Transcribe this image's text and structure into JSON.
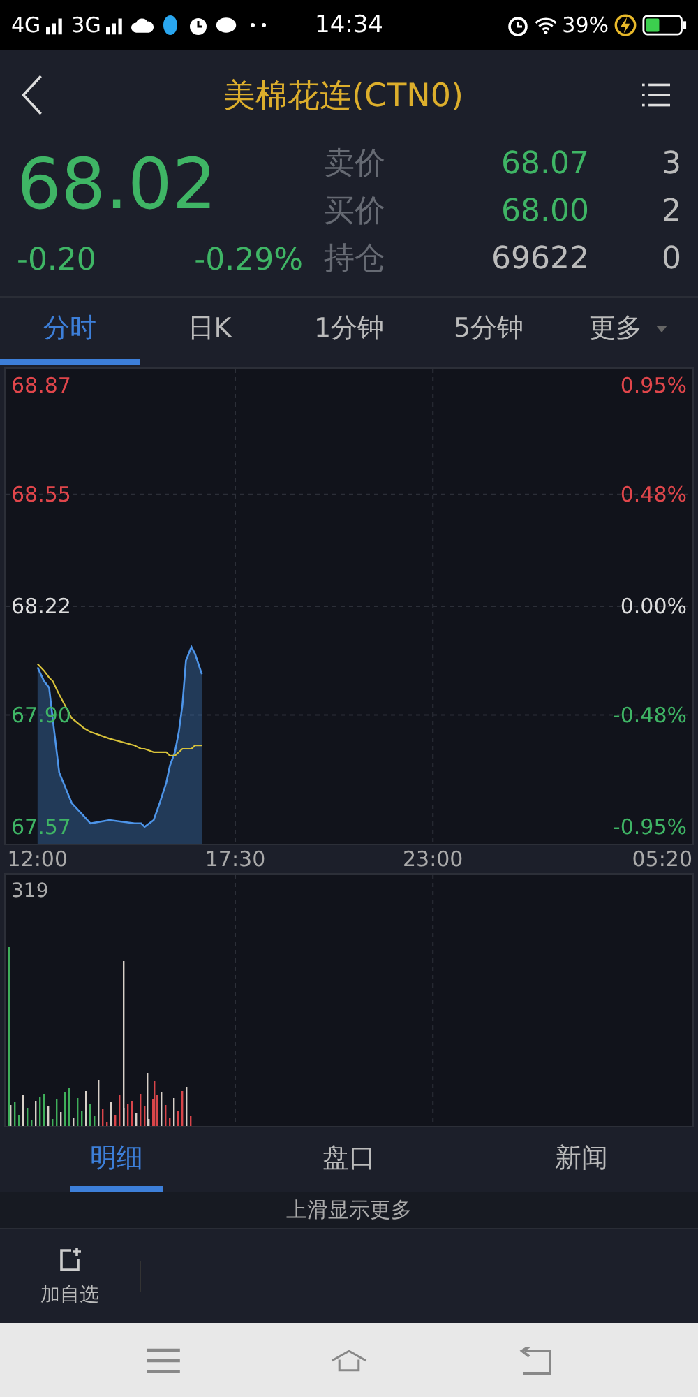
{
  "status_bar": {
    "network_1": "4G",
    "network_2": "3G",
    "time": "14:34",
    "battery_percent": "39%"
  },
  "header": {
    "title": "美棉花连(CTN0)"
  },
  "quote": {
    "price": "68.02",
    "change": "-0.20",
    "change_percent": "-0.29%",
    "rows": [
      {
        "label": "卖价",
        "value": "68.07",
        "volume": "3",
        "kind": "price"
      },
      {
        "label": "买价",
        "value": "68.00",
        "volume": "2",
        "kind": "price"
      },
      {
        "label": "持仓",
        "value": "69622",
        "volume": "0",
        "kind": "plain"
      }
    ]
  },
  "chart_tabs": [
    {
      "label": "分时",
      "selected": true,
      "dropdown": false
    },
    {
      "label": "日K",
      "selected": false,
      "dropdown": false
    },
    {
      "label": "1分钟",
      "selected": false,
      "dropdown": false
    },
    {
      "label": "5分钟",
      "selected": false,
      "dropdown": false
    },
    {
      "label": "更多",
      "selected": false,
      "dropdown": true
    }
  ],
  "price_chart": {
    "chart_data": {
      "type": "line",
      "x": [
        12,
        12.18,
        12.32,
        12.42,
        12.6,
        12.95,
        13.3,
        13.47,
        14,
        14.7,
        14.88,
        14.98,
        15.23,
        15.4,
        15.58,
        15.68,
        15.82,
        15.93,
        16.03,
        16.13,
        16.28,
        16.38,
        16.57
      ],
      "series": [
        {
          "color": "#4d94e8",
          "values": [
            68.04,
            68.0,
            67.98,
            67.89,
            67.73,
            67.64,
            67.6,
            67.58,
            67.59,
            67.58,
            67.58,
            67.57,
            67.59,
            67.64,
            67.7,
            67.75,
            67.79,
            67.85,
            67.93,
            68.06,
            68.1,
            68.08,
            68.02
          ]
        },
        {
          "color": "#d8c23a",
          "values": [
            68.05,
            68.03,
            68.01,
            68.0,
            67.96,
            67.89,
            67.86,
            67.85,
            67.83,
            67.81,
            67.8,
            67.8,
            67.79,
            67.79,
            67.79,
            67.78,
            67.78,
            67.79,
            67.8,
            67.8,
            67.8,
            67.81,
            67.81
          ]
        }
      ],
      "grid": true,
      "xlim": [
        11.11,
        30.22
      ],
      "ylim": [
        67.52,
        68.92
      ],
      "xticks": [
        {
          "value": 12,
          "label": "12:00"
        },
        {
          "value": 17.5,
          "label": "17:30"
        },
        {
          "value": 23,
          "label": "23:00"
        }
      ],
      "yticks": [
        {
          "value": 68.87,
          "label": "68.87"
        },
        {
          "value": 68.55,
          "label": "68.55"
        },
        {
          "value": 68.22,
          "label": "68.22"
        },
        {
          "value": 67.9,
          "label": "67.90"
        },
        {
          "value": 67.57,
          "label": "67.57"
        }
      ]
    },
    "end_time_label": "05:20",
    "percent_labels": [
      "0.95%",
      "0.48%",
      "0.00%",
      "-0.48%",
      "-0.95%"
    ]
  },
  "volume_chart": {
    "max_label": "319"
  },
  "detail_tabs": [
    {
      "label": "明细",
      "selected": true
    },
    {
      "label": "盘口",
      "selected": false
    },
    {
      "label": "新闻",
      "selected": false
    }
  ],
  "more_hint": "上滑显示更多",
  "toolbar": {
    "add_watchlist": "加自选"
  }
}
